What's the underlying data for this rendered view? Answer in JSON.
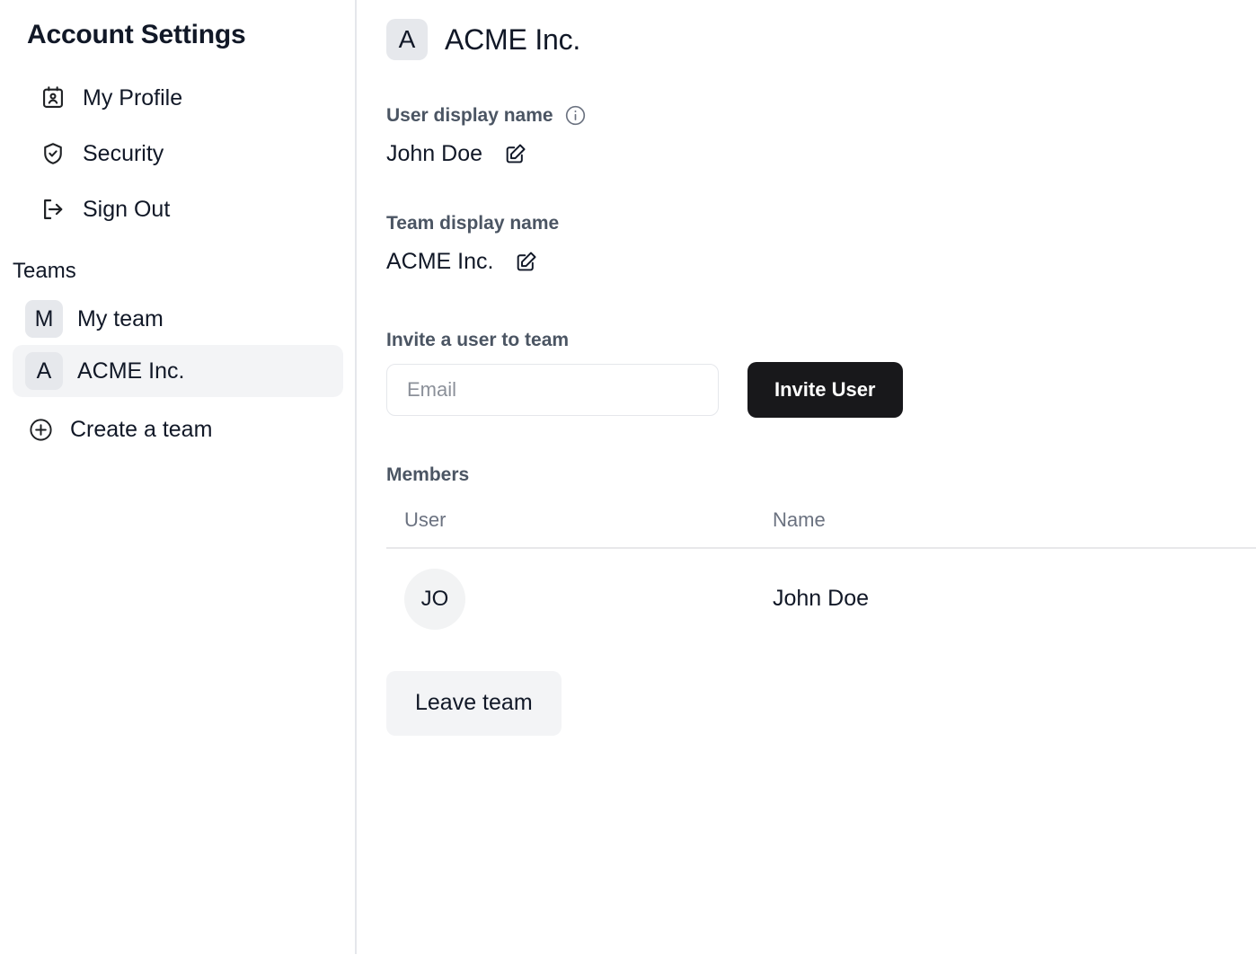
{
  "sidebar": {
    "title": "Account Settings",
    "nav_items": [
      {
        "label": "My Profile",
        "icon": "contact-card-icon"
      },
      {
        "label": "Security",
        "icon": "shield-check-icon"
      },
      {
        "label": "Sign Out",
        "icon": "sign-out-icon"
      }
    ],
    "teams_heading": "Teams",
    "teams": [
      {
        "badge": "M",
        "label": "My team",
        "selected": false
      },
      {
        "badge": "A",
        "label": "ACME Inc.",
        "selected": true
      }
    ],
    "create_team": {
      "label": "Create a team",
      "icon": "plus-circle-icon"
    }
  },
  "main": {
    "header": {
      "badge": "A",
      "title": "ACME Inc."
    },
    "user_display_name": {
      "label": "User display name",
      "info_icon": "info-icon",
      "value": "John Doe",
      "edit_icon": "edit-icon"
    },
    "team_display_name": {
      "label": "Team display name",
      "value": "ACME Inc.",
      "edit_icon": "edit-icon"
    },
    "invite": {
      "label": "Invite a user to team",
      "email_value": "",
      "email_placeholder": "Email",
      "button_label": "Invite User"
    },
    "members": {
      "heading": "Members",
      "columns": [
        "User",
        "Name"
      ],
      "rows": [
        {
          "initials": "JO",
          "name": "John Doe"
        }
      ]
    },
    "leave_button_label": "Leave team"
  },
  "colors": {
    "accent_dark": "#18181b",
    "badge_bg": "#e6e8ec",
    "selected_row_bg": "#f3f4f6",
    "label_gray": "#4b5563",
    "muted_gray": "#6b7280",
    "divider": "#e5e7eb"
  }
}
